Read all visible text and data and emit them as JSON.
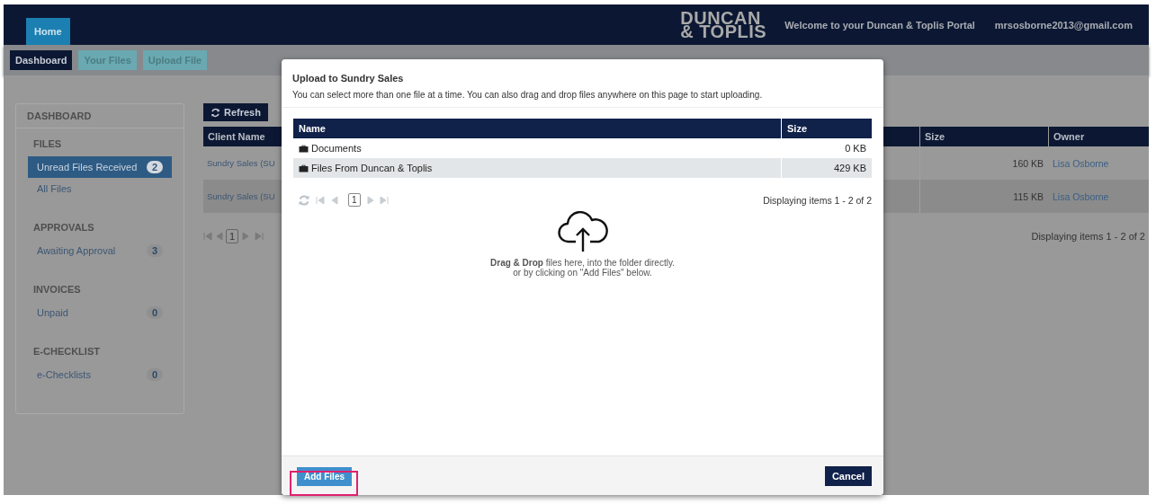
{
  "header": {
    "home_tab": "Home",
    "logo": [
      "DUNCAN",
      "& TOPLIS"
    ],
    "welcome": "Welcome to your Duncan & Toplis Portal",
    "user_email": "mrsosborne2013@gmail.com"
  },
  "nav_tabs": [
    {
      "label": "Dashboard",
      "selected": true
    },
    {
      "label": "Your Files",
      "selected": false
    },
    {
      "label": "Upload File",
      "selected": false
    }
  ],
  "sidebar": {
    "title": "DASHBOARD",
    "sections": [
      {
        "heading": "FILES",
        "items": [
          {
            "label": "Unread Files Received",
            "count": "2",
            "selected": true
          },
          {
            "label": "All Files",
            "selected": false
          }
        ]
      },
      {
        "heading": "APPROVALS",
        "items": [
          {
            "label": "Awaiting Approval",
            "count": "3",
            "selected": false
          }
        ]
      },
      {
        "heading": "INVOICES",
        "items": [
          {
            "label": "Unpaid",
            "count": "0",
            "selected": false
          }
        ]
      },
      {
        "heading": "E-CHECKLIST",
        "items": [
          {
            "label": "e-Checklists",
            "count": "0",
            "selected": false
          }
        ]
      }
    ]
  },
  "files_table": {
    "refresh": "Refresh",
    "columns": [
      "Client Name",
      "Size",
      "Owner"
    ],
    "rows": [
      {
        "client": "Sundry Sales (SU",
        "size": "160 KB",
        "owner": "Lisa Osborne"
      },
      {
        "client": "Sundry Sales (SU",
        "size": "115 KB",
        "owner": "Lisa Osborne"
      }
    ],
    "page": "1",
    "status": "Displaying items 1 - 2 of 2"
  },
  "modal": {
    "title": "Upload to Sundry Sales",
    "subtitle": "You can select more than one file at a time. You can also drag and drop files anywhere on this page to start uploading.",
    "columns": [
      "Name",
      "Size"
    ],
    "rows": [
      {
        "name": "Documents",
        "size": "0 KB"
      },
      {
        "name": "Files From Duncan & Toplis",
        "size": "429 KB"
      }
    ],
    "page": "1",
    "status": "Displaying items 1 - 2 of 2",
    "drop_text": [
      "**Drag & Drop** files here, into the folder directly.",
      "or by clicking on \"Add Files\" below."
    ],
    "add_button": "Add Files",
    "cancel_button": "Cancel"
  }
}
